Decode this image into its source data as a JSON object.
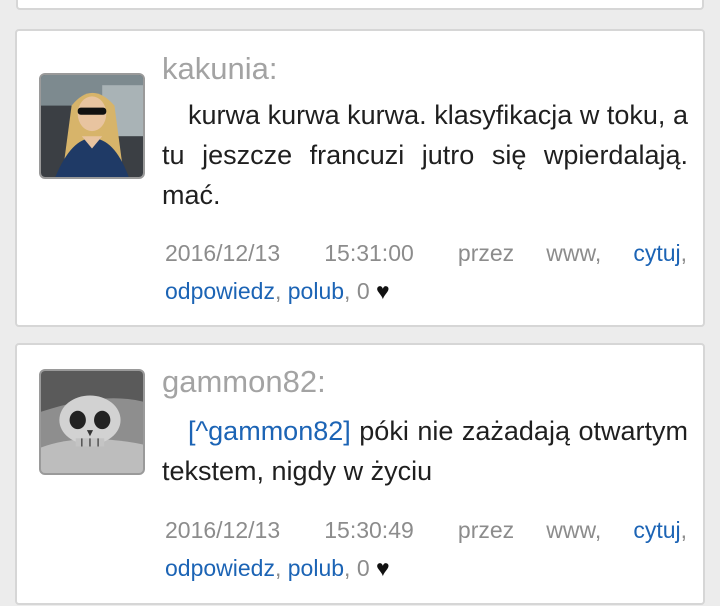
{
  "comments": [
    {
      "username": "kakunia:",
      "text": "kurwa kurwa kurwa. klasyfikacja w toku, a tu jeszcze francuzi jutro się wpierdalają. mać.",
      "date": "2016/12/13",
      "time": "15:31:00",
      "via": "przez www,",
      "quote_label": "cytuj",
      "reply_label": "odpowiedz",
      "like_label": "polub",
      "like_count": "0",
      "heart": "♥",
      "avatar_icon": "user-photo-avatar"
    },
    {
      "username": "gammon82:",
      "mention": "[^gammon82]",
      "text": " póki nie zażadają otwartym tekstem, nigdy w życiu",
      "date": "2016/12/13",
      "time": "15:30:49",
      "via": "przez www,",
      "quote_label": "cytuj",
      "reply_label": "odpowiedz",
      "like_label": "polub",
      "like_count": "0",
      "heart": "♥",
      "avatar_icon": "skull-avatar"
    }
  ],
  "colors": {
    "link": "#1c64b5",
    "meta": "#8c8c8c",
    "username": "#a3a3a3",
    "background": "#ececec"
  }
}
